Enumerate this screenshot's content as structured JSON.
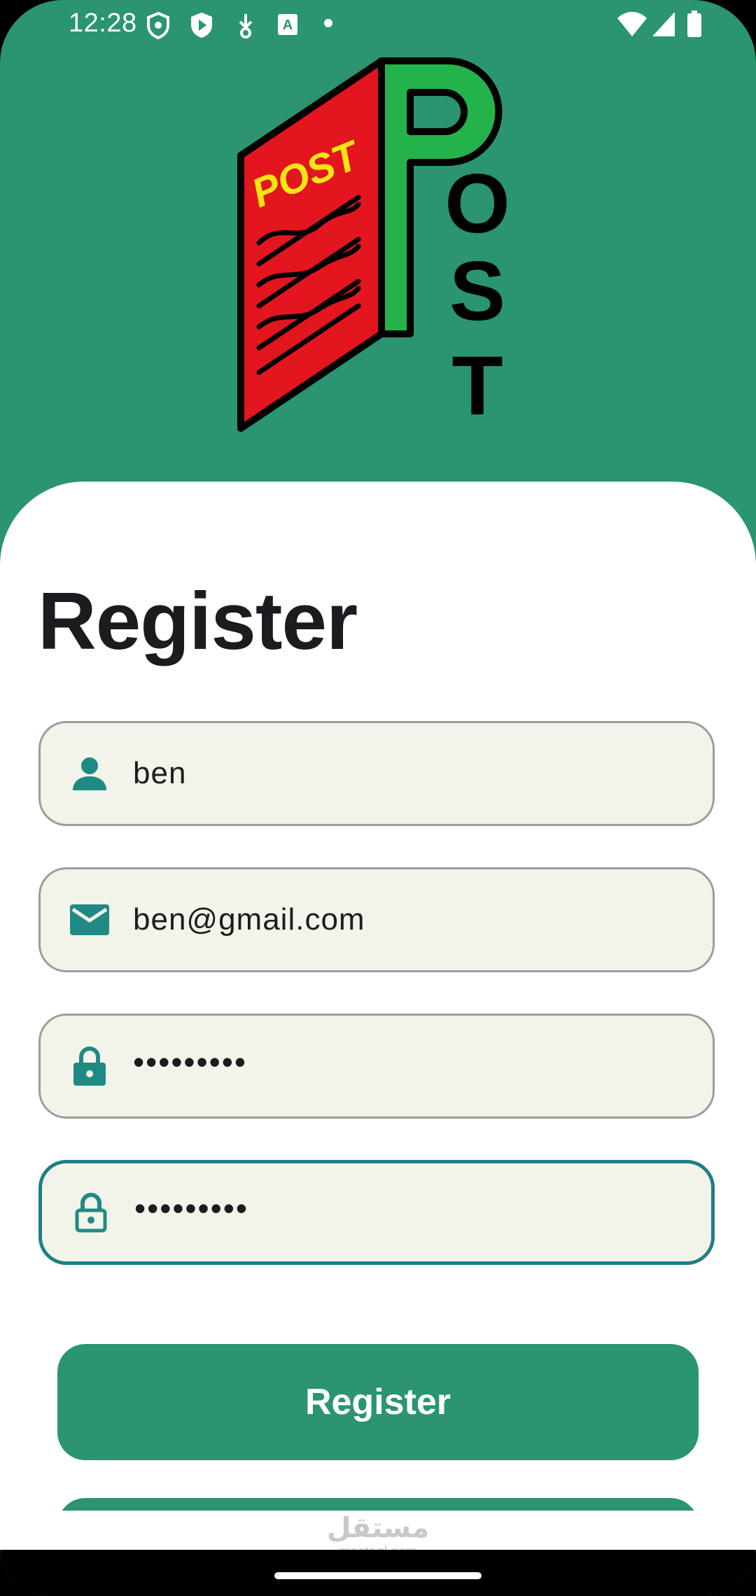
{
  "status_bar": {
    "time": "12:28",
    "icons_left": [
      "shield-icon",
      "play-protect-icon",
      "download-icon",
      "keyboard-a-icon",
      "dot-icon"
    ],
    "icons_right": [
      "wifi-icon",
      "signal-icon",
      "battery-icon"
    ]
  },
  "logo": {
    "badge_text": "POST",
    "letters": [
      "P",
      "O",
      "S",
      "T"
    ],
    "colors": {
      "book": "#e3151f",
      "badge_text": "#f5e612",
      "letter_p": "#23b34a",
      "outline": "#000000"
    }
  },
  "form": {
    "title": "Register",
    "fields": [
      {
        "icon": "person-icon",
        "value": "ben"
      },
      {
        "icon": "email-icon",
        "value": "ben@gmail.com"
      },
      {
        "icon": "lock-icon",
        "value": "•••••••••"
      },
      {
        "icon": "lock-outline-icon",
        "value": "•••••••••",
        "focused": true
      }
    ],
    "register_button": "Register"
  },
  "watermark": {
    "arabic": "مستقل",
    "latin": "mostaql.com"
  },
  "theme": {
    "primary": "#2a9570",
    "field_bg": "#f3f4e9",
    "icon": "#1f8a84",
    "focus_border": "#1f7e86"
  }
}
